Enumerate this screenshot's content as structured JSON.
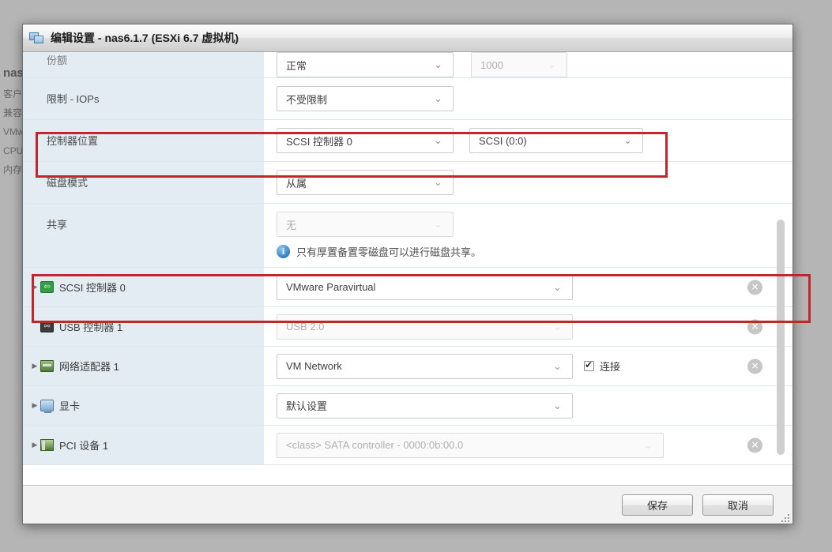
{
  "background": {
    "vm_title": "nas",
    "rows": [
      "客户",
      "兼容",
      "VMw",
      "CPU",
      "内存"
    ]
  },
  "dialog": {
    "title": "编辑设置 - nas6.1.7 (ESXi 6.7 虚拟机)",
    "title_icon": "virtual-machine-icon",
    "settings_rows": [
      {
        "label": "份额",
        "value": "正常",
        "number_value": "1000"
      },
      {
        "label": "限制 - IOPs",
        "value": "不受限制"
      },
      {
        "label": "控制器位置",
        "value": "SCSI 控制器 0",
        "node_value": "SCSI (0:0)"
      },
      {
        "label": "磁盘模式",
        "value": "从属"
      },
      {
        "label": "共享",
        "value": "无",
        "info": "只有厚置备置零磁盘可以进行磁盘共享。"
      }
    ],
    "device_rows": [
      {
        "name": "SCSI 控制器 0",
        "icon": "scsi-controller-icon",
        "value": "VMware Paravirtual",
        "expandable": true,
        "disabled": false,
        "removable": true
      },
      {
        "name": "USB 控制器 1",
        "icon": "usb-controller-icon",
        "value": "USB 2.0",
        "expandable": false,
        "disabled": true,
        "removable": true
      },
      {
        "name": "网络适配器 1",
        "icon": "network-adapter-icon",
        "value": "VM Network",
        "expandable": true,
        "disabled": false,
        "removable": true,
        "checkbox_label": "连接",
        "checkbox_checked": true
      },
      {
        "name": "显卡",
        "icon": "video-card-icon",
        "value": "默认设置",
        "expandable": true,
        "disabled": false,
        "removable": false
      },
      {
        "name": "PCI 设备 1",
        "icon": "pci-device-icon",
        "value": "<class> SATA controller - 0000:0b:00.0",
        "expandable": true,
        "disabled": true,
        "removable": true
      }
    ],
    "footer": {
      "save_label": "保存",
      "cancel_label": "取消"
    }
  },
  "annotations": {
    "color": "#c0262c",
    "boxes": [
      {
        "target": "控制器位置"
      },
      {
        "target": "SCSI 控制器 0"
      }
    ]
  }
}
